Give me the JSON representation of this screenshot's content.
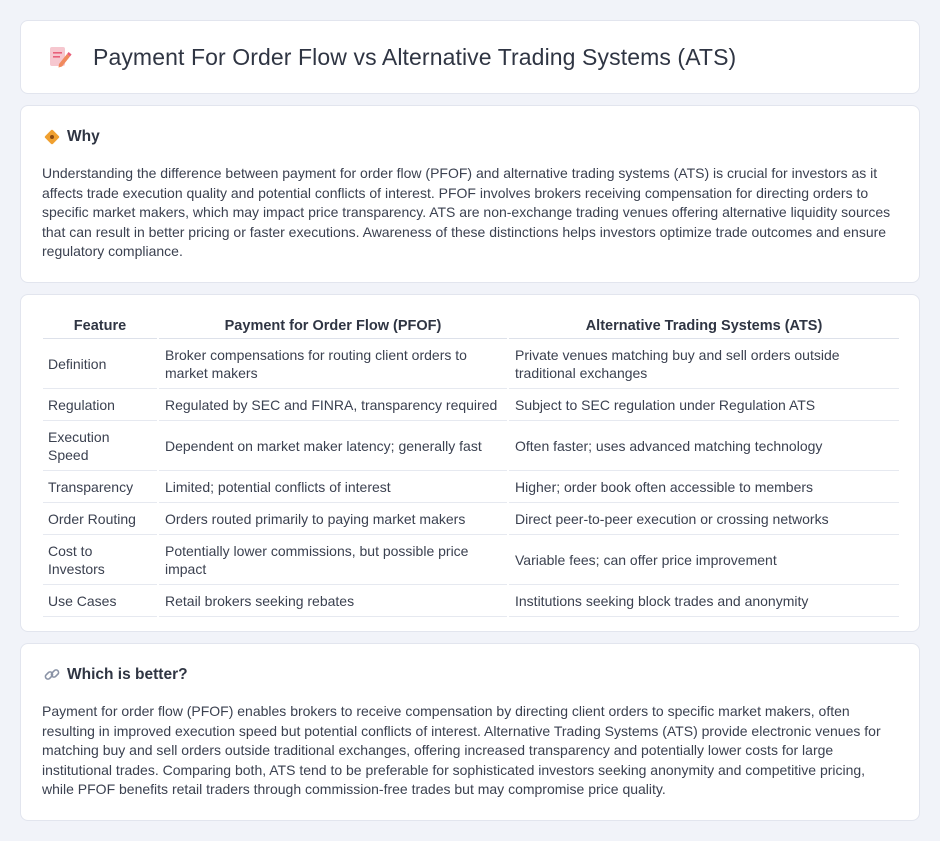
{
  "header": {
    "title": "Payment For Order Flow vs Alternative Trading Systems (ATS)",
    "icon": "document-edit-icon"
  },
  "why": {
    "heading": "Why",
    "icon": "diamond-sign-icon",
    "text": "Understanding the difference between payment for order flow (PFOF) and alternative trading systems (ATS) is crucial for investors as it affects trade execution quality and potential conflicts of interest. PFOF involves brokers receiving compensation for directing orders to specific market makers, which may impact price transparency. ATS are non-exchange trading venues offering alternative liquidity sources that can result in better pricing or faster executions. Awareness of these distinctions helps investors optimize trade outcomes and ensure regulatory compliance."
  },
  "comparison": {
    "columns": [
      "Feature",
      "Payment for Order Flow (PFOF)",
      "Alternative Trading Systems (ATS)"
    ],
    "rows": [
      {
        "feature": "Definition",
        "pfof": "Broker compensations for routing client orders to market makers",
        "ats": "Private venues matching buy and sell orders outside traditional exchanges"
      },
      {
        "feature": "Regulation",
        "pfof": "Regulated by SEC and FINRA, transparency required",
        "ats": "Subject to SEC regulation under Regulation ATS"
      },
      {
        "feature": "Execution Speed",
        "pfof": "Dependent on market maker latency; generally fast",
        "ats": "Often faster; uses advanced matching technology"
      },
      {
        "feature": "Transparency",
        "pfof": "Limited; potential conflicts of interest",
        "ats": "Higher; order book often accessible to members"
      },
      {
        "feature": "Order Routing",
        "pfof": "Orders routed primarily to paying market makers",
        "ats": "Direct peer-to-peer execution or crossing networks"
      },
      {
        "feature": "Cost to Investors",
        "pfof": "Potentially lower commissions, but possible price impact",
        "ats": "Variable fees; can offer price improvement"
      },
      {
        "feature": "Use Cases",
        "pfof": "Retail brokers seeking rebates",
        "ats": "Institutions seeking block trades and anonymity"
      }
    ]
  },
  "better": {
    "heading": "Which is better?",
    "icon": "link-icon",
    "text": "Payment for order flow (PFOF) enables brokers to receive compensation by directing client orders to specific market makers, often resulting in improved execution speed but potential conflicts of interest. Alternative Trading Systems (ATS) provide electronic venues for matching buy and sell orders outside traditional exchanges, offering increased transparency and potentially lower costs for large institutional trades. Comparing both, ATS tend to be preferable for sophisticated investors seeking anonymity and competitive pricing, while PFOF benefits retail traders through commission-free trades but may compromise price quality."
  },
  "colors": {
    "background": "#f1f3f9",
    "card": "#ffffff",
    "accent_orange": "#f0a030",
    "icon_pink": "#e8607a"
  }
}
